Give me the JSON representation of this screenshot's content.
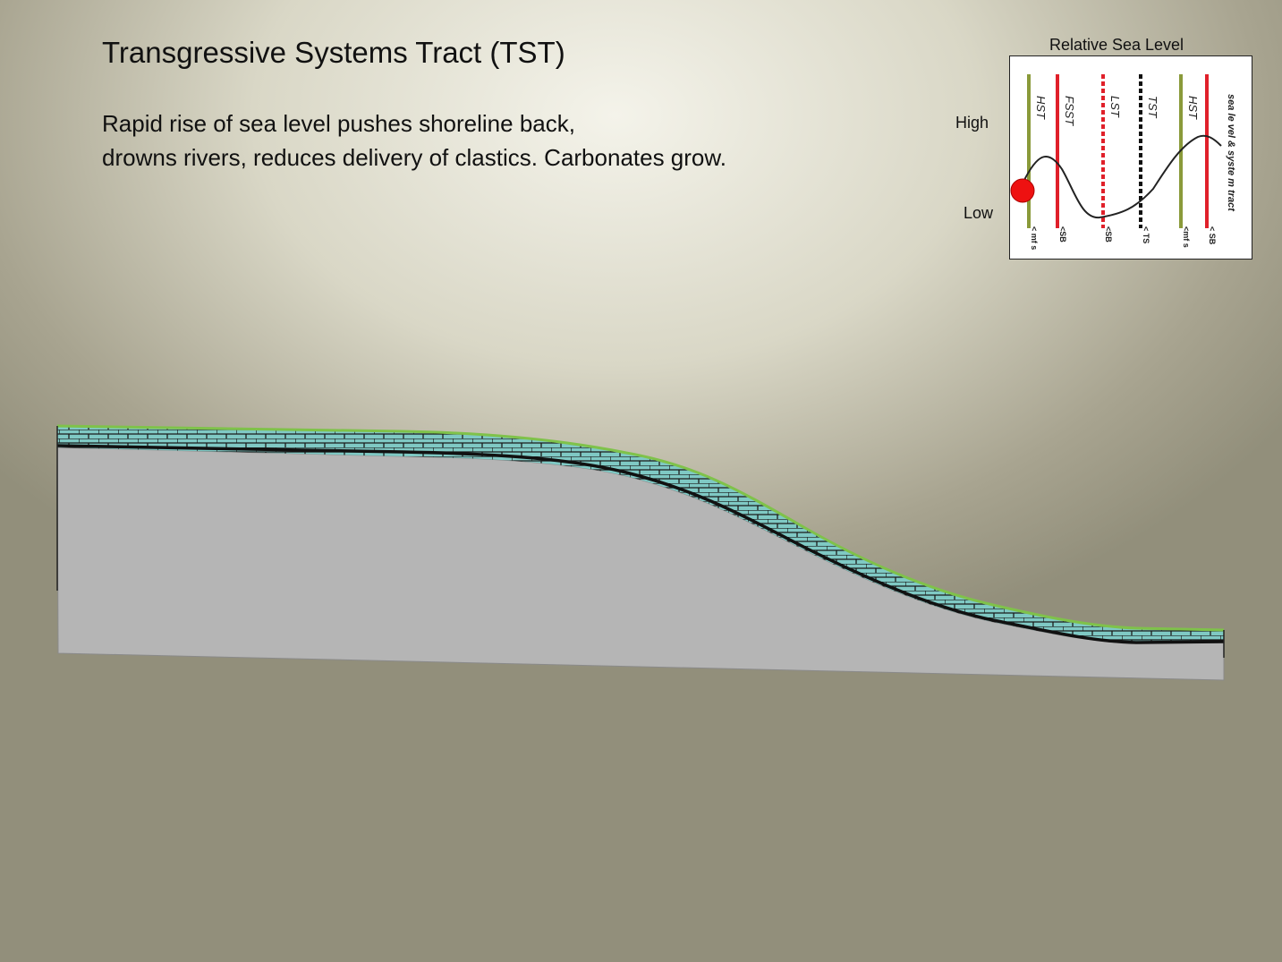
{
  "slide": {
    "title": "Transgressive Systems Tract (TST)",
    "description_lines": [
      "Rapid rise of sea level pushes shoreline back,",
      "drowns rivers, reduces delivery of clastics.  Carbonates grow."
    ]
  },
  "inset": {
    "title": "Relative Sea Level",
    "high_label": "High",
    "low_label": "Low",
    "side_label": "sea le vel & syste m tract",
    "tracts": [
      {
        "name": "HST",
        "surface": "< mf s",
        "color": "#8a9a3a",
        "style": "solid"
      },
      {
        "name": "FSST",
        "surface": "<SB",
        "color": "#e0202a",
        "style": "solid"
      },
      {
        "name": "LST",
        "surface": "<SB",
        "color": "#e0202a",
        "style": "dashed"
      },
      {
        "name": "TST",
        "surface": "< TS",
        "color": "#111111",
        "style": "dashed"
      },
      {
        "name": "HST",
        "surface": "<mf s",
        "color": "#8a9a3a",
        "style": "solid"
      },
      {
        "name": "",
        "surface": "< SB",
        "color": "#e0202a",
        "style": "solid"
      }
    ],
    "marker_color": "#ee1111"
  },
  "colors": {
    "basement": "#b5b5b5",
    "carbonate": "#7fc9c4",
    "surface_line": "#7fc24a"
  }
}
